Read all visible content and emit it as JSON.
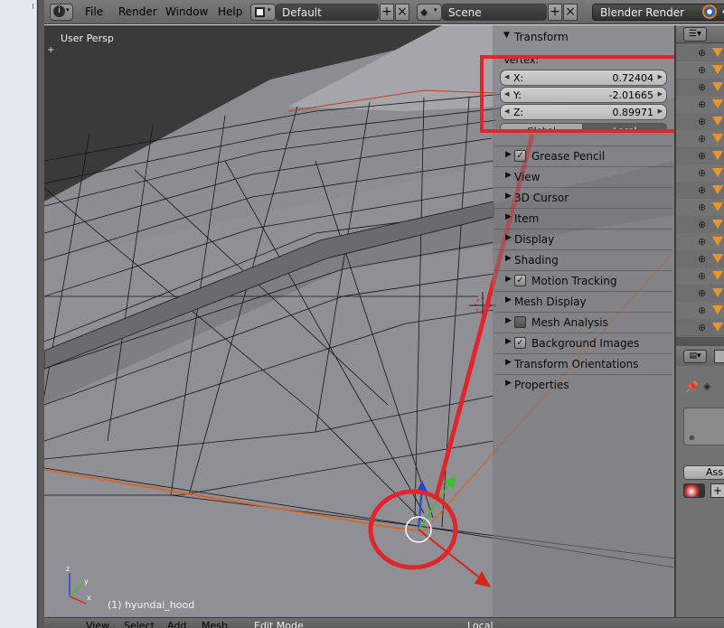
{
  "topbar": {
    "menus": [
      "File",
      "Render",
      "Window",
      "Help"
    ],
    "layout_field": "Default",
    "scene_field": "Scene",
    "render_engine": "Blender Render"
  },
  "viewport": {
    "view_label": "User Persp",
    "object_label": "(1) hyundai_hood"
  },
  "npanel": {
    "transform_header": "Transform",
    "vertex_label": "Vertex:",
    "x_label": "X:",
    "x_value": "0.72404",
    "y_label": "Y:",
    "y_value": "-2.01665",
    "z_label": "Z:",
    "z_value": "0.89971",
    "global_btn": "Global",
    "local_btn": "Local",
    "sections": [
      {
        "label": "Grease Pencil",
        "checkbox": true,
        "checked": true
      },
      {
        "label": "View",
        "checkbox": false
      },
      {
        "label": "3D Cursor",
        "checkbox": false
      },
      {
        "label": "Item",
        "checkbox": false
      },
      {
        "label": "Display",
        "checkbox": false
      },
      {
        "label": "Shading",
        "checkbox": false
      },
      {
        "label": "Motion Tracking",
        "checkbox": true,
        "checked": true
      },
      {
        "label": "Mesh Display",
        "checkbox": false
      },
      {
        "label": "Mesh Analysis",
        "checkbox": true,
        "checked": false
      },
      {
        "label": "Background Images",
        "checkbox": true,
        "checked": true
      },
      {
        "label": "Transform Orientations",
        "checkbox": false
      },
      {
        "label": "Properties",
        "checkbox": false
      }
    ]
  },
  "right_panel": {
    "assign_button": "Assi"
  },
  "bottom_bar": {
    "items": [
      "View",
      "Select",
      "Add",
      "Mesh",
      "Edit Mode",
      "Local"
    ]
  },
  "colors": {
    "annotation_red": "#e0262d",
    "outliner_mesh_icon": "#e8962b",
    "edge_orange": "#d9661c"
  }
}
